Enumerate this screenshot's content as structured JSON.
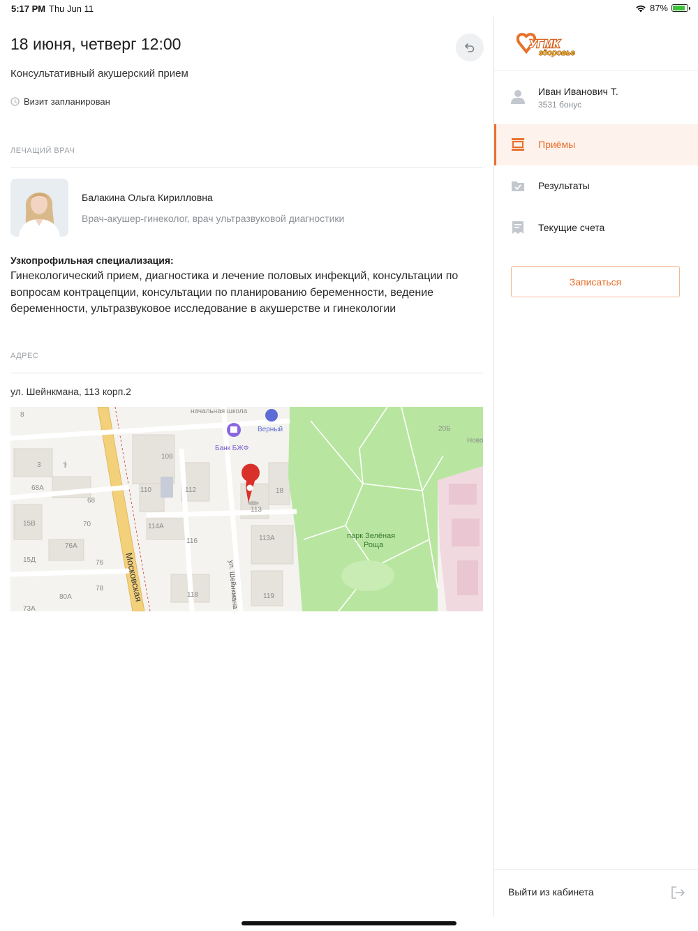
{
  "status_bar": {
    "time": "5:17 PM",
    "date": "Thu Jun 11",
    "battery": "87%",
    "battery_level": 0.87
  },
  "appointment": {
    "datetime": "18 июня, четверг 12:00",
    "service": "Консультативный акушерский прием",
    "status": "Визит запланирован"
  },
  "doctor_section": {
    "label": "ЛЕЧАЩИЙ ВРАЧ",
    "name": "Балакина Ольга Кирилловна",
    "role": "Врач-акушер-гинеколог, врач ультразвуковой диагностики",
    "specialization_title": "Узкопрофильная специализация:",
    "specialization_text": "Гинекологический прием, диагностика и лечение половых инфекций, консультации по вопросам контрацепции, консультации по планированию беременности, ведение беременности, ультразвуковое исследование в акушерстве и гинекологии"
  },
  "address_section": {
    "label": "АДРЕС",
    "address": "ул. Шейнкмана, 113 корп.2"
  },
  "map": {
    "labels": {
      "school": "начальная школа",
      "shop": "Верный",
      "bank": "Банк БЖФ",
      "park": "парк Зелёная",
      "park2": "Роща",
      "street1": "Московская",
      "street2": "ул. Шейнкмана",
      "nov": "Ново",
      "b8": "8",
      "b3": "3",
      "b68a": "68А",
      "b68": "68",
      "b15v": "15В",
      "b15d": "15Д",
      "b70": "70",
      "b76a": "76А",
      "b76": "76",
      "b78": "78",
      "b80a": "80А",
      "b73a": "73А",
      "b108": "108",
      "b110": "110",
      "b112": "112",
      "b114a": "114А",
      "b116": "116",
      "b118": "118",
      "b18": "18",
      "b113": "113",
      "b113a": "113А",
      "b119": "119",
      "b20b": "20Б"
    }
  },
  "sidebar": {
    "logo_text": "УГМК",
    "logo_sub": "здоровье",
    "user_name": "Иван Иванович Т.",
    "user_bonus": "3531 бонус",
    "nav": [
      {
        "label": "Приёмы",
        "icon": "appointments-icon",
        "active": true
      },
      {
        "label": "Результаты",
        "icon": "results-folder-icon",
        "active": false
      },
      {
        "label": "Текущие счета",
        "icon": "receipt-icon",
        "active": false
      }
    ],
    "book_button": "Записаться",
    "logout": "Выйти из кабинета"
  },
  "colors": {
    "accent": "#e86f2c",
    "accent_bg": "#fdf2ec",
    "muted": "#8b9197",
    "park": "#b8e6a0",
    "map_bg": "#f4f3ef",
    "pin": "#d9302a"
  }
}
